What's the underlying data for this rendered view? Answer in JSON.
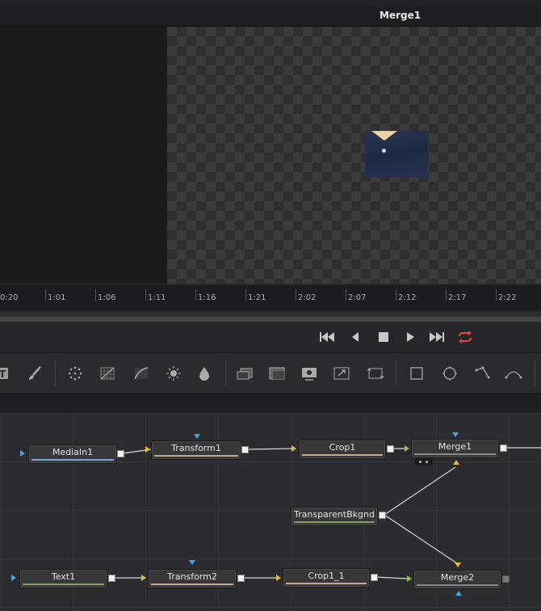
{
  "viewer": {
    "title": "Merge1"
  },
  "timeline": {
    "labels": [
      "0:20",
      "1:01",
      "1:06",
      "1:11",
      "1:16",
      "1:21",
      "2:02",
      "2:07",
      "2:12",
      "2:17",
      "2:22"
    ]
  },
  "transport": {
    "buttons": [
      "skip-to-start",
      "step-back",
      "stop",
      "play",
      "skip-to-end",
      "loop"
    ],
    "loop_color": "#e64a3c"
  },
  "toolbar": {
    "tools": [
      "text-tool",
      "paint-brush",
      "particles",
      "gradient-grid",
      "curves",
      "brightness",
      "color-drop",
      "merge-layers",
      "background",
      "media-in",
      "resize",
      "transform",
      "rectangle-mask",
      "ellipse-mask",
      "polygon-mask",
      "bspline-mask"
    ]
  },
  "nodes": {
    "mediain1": "MediaIn1",
    "transform1": "Transform1",
    "crop1": "Crop1",
    "merge1": "Merge1",
    "transparent_bkgnd": "TransparentBkgnd",
    "text1": "Text1",
    "transform2": "Transform2",
    "crop1_1": "Crop1_1",
    "merge2": "Merge2"
  },
  "colors": {
    "accent_blue": "#3ea6e8",
    "input_yellow": "#e8b93a",
    "mask_green": "#8bc34a"
  }
}
